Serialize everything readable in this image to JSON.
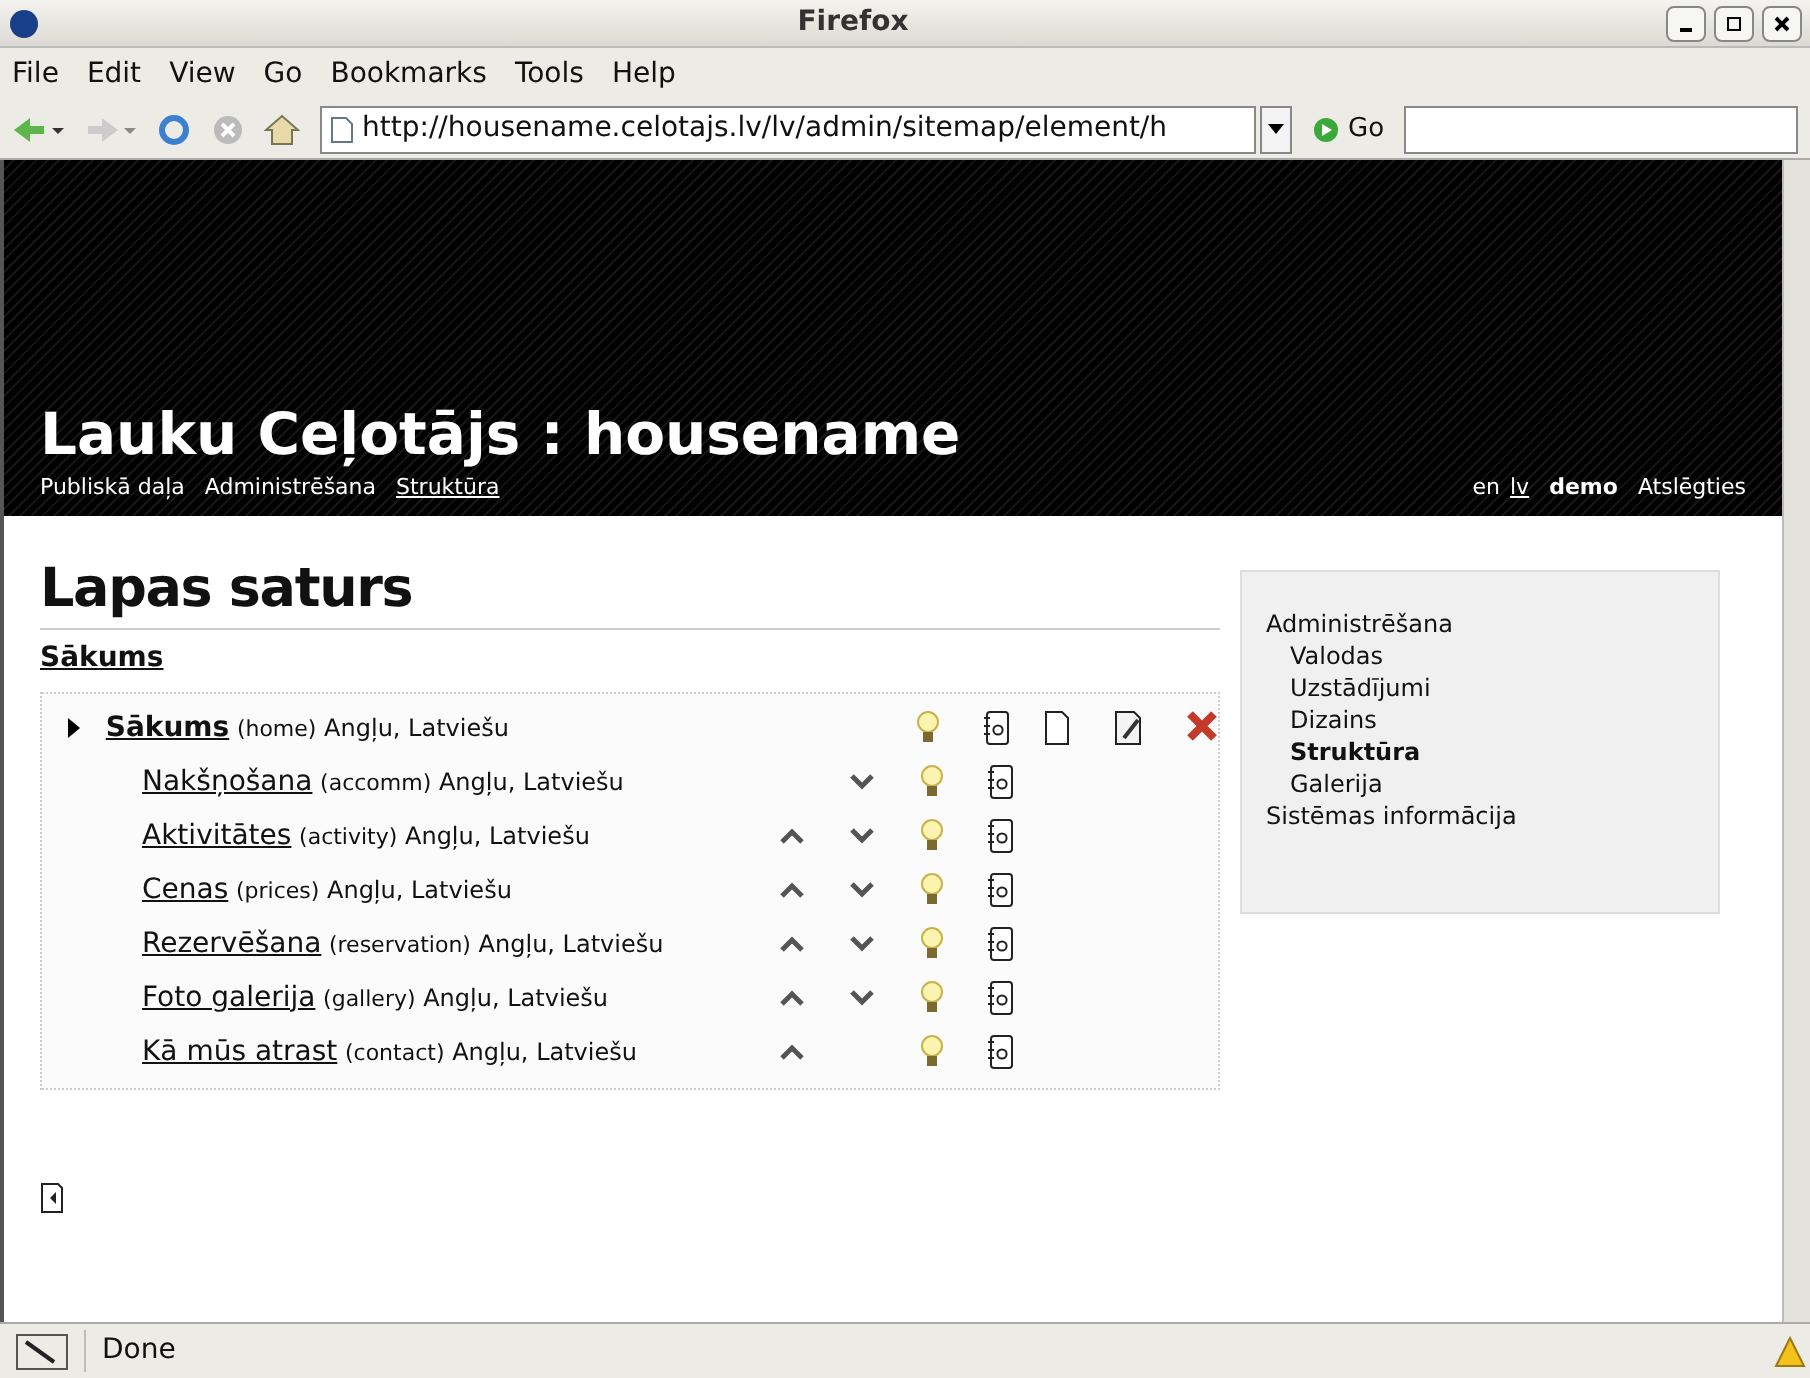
{
  "window": {
    "title": "Firefox"
  },
  "menu": [
    "File",
    "Edit",
    "View",
    "Go",
    "Bookmarks",
    "Tools",
    "Help"
  ],
  "toolbar": {
    "url": "http://housename.celotajs.lv/lv/admin/sitemap/element/h",
    "go": "Go"
  },
  "header": {
    "title": "Lauku Ceļotājs : housename",
    "nav": [
      {
        "label": "Publiskā daļa",
        "selected": false
      },
      {
        "label": "Administrēšana",
        "selected": false
      },
      {
        "label": "Struktūra",
        "selected": true
      }
    ],
    "langs": [
      {
        "label": "en",
        "selected": false
      },
      {
        "label": "lv",
        "selected": true
      }
    ],
    "user": "demo",
    "logout": "Atslēgties"
  },
  "page": {
    "heading": "Lapas saturs",
    "breadcrumb": "Sākums"
  },
  "tree": [
    {
      "kind": "root",
      "name": "Sākums",
      "slug": "(home)",
      "langs": "Angļu, Latviešu",
      "up": false,
      "down": false
    },
    {
      "kind": "child",
      "name": "Nakšņošana",
      "slug": "(accomm)",
      "langs": "Angļu, Latviešu",
      "up": false,
      "down": true
    },
    {
      "kind": "child",
      "name": "Aktivitātes",
      "slug": "(activity)",
      "langs": "Angļu, Latviešu",
      "up": true,
      "down": true
    },
    {
      "kind": "child",
      "name": "Cenas",
      "slug": "(prices)",
      "langs": "Angļu, Latviešu",
      "up": true,
      "down": true
    },
    {
      "kind": "child",
      "name": "Rezervēšana",
      "slug": "(reservation)",
      "langs": "Angļu, Latviešu",
      "up": true,
      "down": true
    },
    {
      "kind": "child",
      "name": "Foto galerija",
      "slug": "(gallery)",
      "langs": "Angļu, Latviešu",
      "up": true,
      "down": true
    },
    {
      "kind": "child",
      "name": "Kā mūs atrast",
      "slug": "(contact)",
      "langs": "Angļu, Latviešu",
      "up": true,
      "down": false
    }
  ],
  "sidebar": {
    "items": [
      {
        "label": "Administrēšana",
        "selected": false,
        "children": [
          {
            "label": "Valodas",
            "selected": false
          },
          {
            "label": "Uzstādījumi",
            "selected": false
          },
          {
            "label": "Dizains",
            "selected": false
          },
          {
            "label": "Struktūra",
            "selected": true
          },
          {
            "label": "Galerija",
            "selected": false
          }
        ]
      },
      {
        "label": "Sistēmas informācija",
        "selected": false
      }
    ]
  },
  "status_bar": {
    "text": "Done"
  }
}
